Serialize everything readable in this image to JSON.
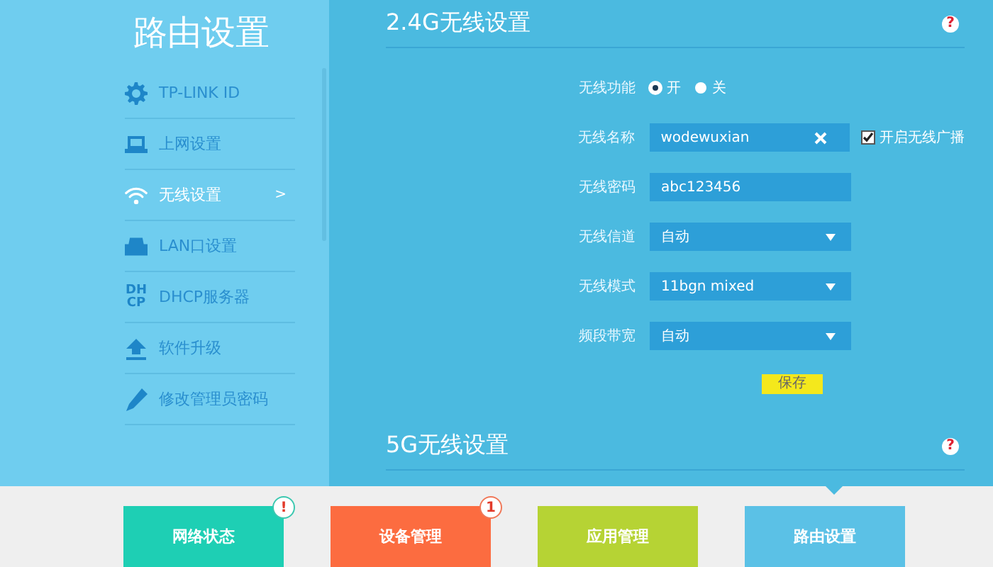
{
  "sidebar": {
    "title": "路由设置",
    "items": [
      {
        "label": "TP-LINK ID",
        "selected": false
      },
      {
        "label": "上网设置",
        "selected": false
      },
      {
        "label": "无线设置",
        "selected": true,
        "arrow": ">"
      },
      {
        "label": "LAN口设置",
        "selected": false
      },
      {
        "icon_text": [
          "DH",
          "CP"
        ],
        "label": "DHCP服务器",
        "selected": false
      },
      {
        "label": "软件升级",
        "selected": false
      },
      {
        "label": "修改管理员密码",
        "selected": false
      }
    ]
  },
  "sections": [
    {
      "title": "2.4G无线设置",
      "help": "?",
      "fields": [
        {
          "kind": "radio",
          "label": "无线功能",
          "options": [
            {
              "label": "开",
              "selected": true
            },
            {
              "label": "关",
              "selected": false
            }
          ]
        },
        {
          "kind": "text",
          "label": "无线名称",
          "value": "wodewuxian",
          "clear_button": true,
          "checkbox": {
            "label": "开启无线广播",
            "checked": true
          }
        },
        {
          "kind": "text",
          "label": "无线密码",
          "value": "abc123456"
        },
        {
          "kind": "select",
          "label": "无线信道",
          "value": "自动"
        },
        {
          "kind": "select",
          "label": "无线模式",
          "value": "11bgn mixed"
        },
        {
          "kind": "select",
          "label": "频段带宽",
          "value": "自动"
        }
      ],
      "save": "保存"
    },
    {
      "title": "5G无线设置",
      "help": "?"
    }
  ],
  "dock": [
    {
      "label": "网络状态",
      "color": "#1ecfb4",
      "badge": "!",
      "selected": false
    },
    {
      "label": "设备管理",
      "color": "#fc6c40",
      "badge": "1",
      "selected": false
    },
    {
      "label": "应用管理",
      "color": "#b6d334",
      "selected": false
    },
    {
      "label": "路由设置",
      "color": "#5bc1e6",
      "selected": true
    }
  ]
}
